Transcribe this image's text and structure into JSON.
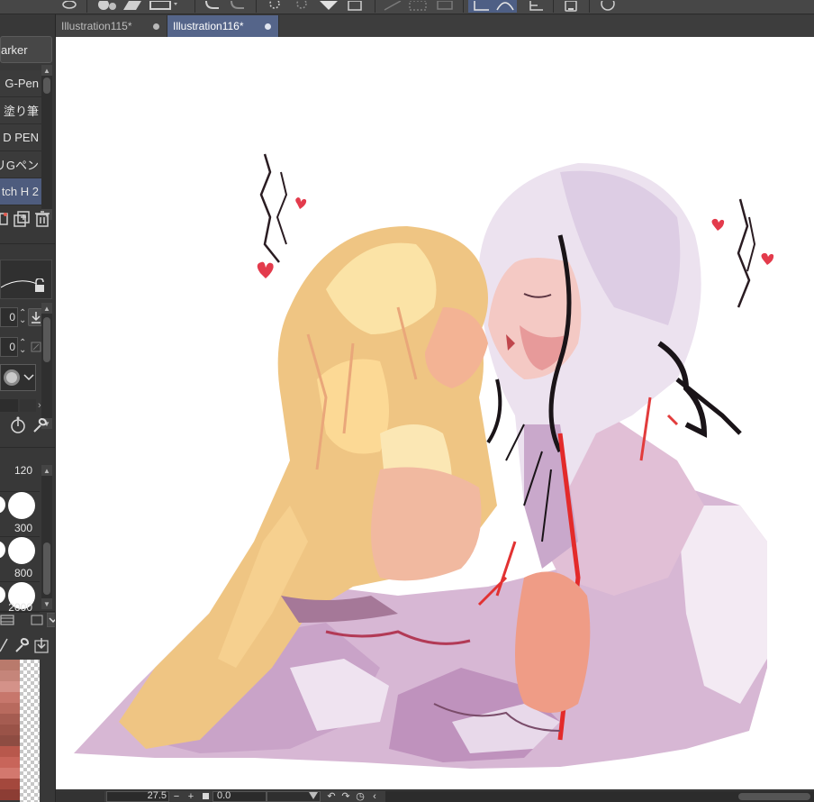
{
  "document_tabs": [
    {
      "label": "Illustration115*",
      "active": false
    },
    {
      "label": "Illustration116*",
      "active": true
    }
  ],
  "sub_tool_group": {
    "label": "arker"
  },
  "brushes": [
    {
      "label": "G-Pen",
      "selected": false
    },
    {
      "label": "塗り筆",
      "selected": false
    },
    {
      "label": "D PEN",
      "selected": false
    },
    {
      "label": "リGペン",
      "selected": false
    },
    {
      "label": "tch H 2",
      "selected": true
    }
  ],
  "tool_property": {
    "size_value": "0",
    "opacity_value": "0"
  },
  "brush_sizes": [
    {
      "label": "120"
    },
    {
      "label": "300"
    },
    {
      "label": "800"
    },
    {
      "label": "2000"
    }
  ],
  "color_swatches": [
    "#b97a6c",
    "#c5857a",
    "#d49289",
    "#c7776c",
    "#b86a5e",
    "#a55c51",
    "#9a5348",
    "#8e4c42",
    "#b8584c",
    "#c8655a",
    "#d3786e",
    "#a4483d",
    "#8c3d34"
  ],
  "status_bar": {
    "zoom": "27.5",
    "zoom_out": "−",
    "zoom_in": "+",
    "rotation": "0.0"
  },
  "colors": {
    "accent_tab": "#55658a",
    "selected_brush": "#4e5c7e",
    "canvas_bg": "#ffffff"
  }
}
